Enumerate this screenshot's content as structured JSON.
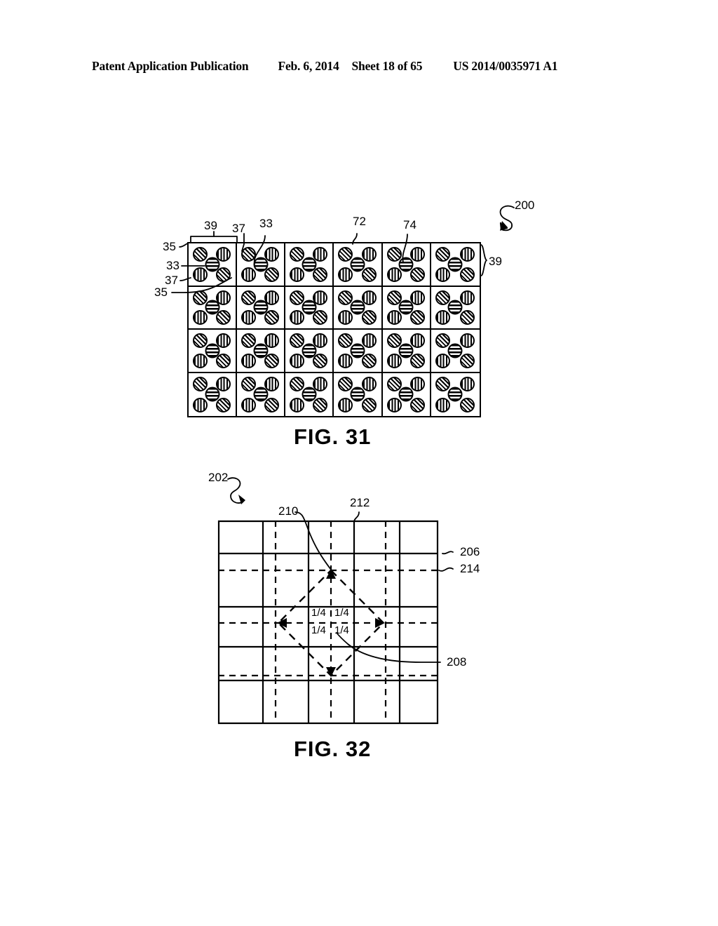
{
  "header": {
    "publication": "Patent Application Publication",
    "date": "Feb. 6, 2014",
    "sheet": "Sheet 18 of 65",
    "patent_number": "US 2014/0035971 A1"
  },
  "figures": [
    {
      "id": "fig31",
      "caption": "FIG. 31",
      "assembly_ref": "200",
      "grid": {
        "columns": 6,
        "rows": 4
      },
      "cell_elements": [
        {
          "position": "top-left",
          "hatch": "diagonal",
          "ref": "35"
        },
        {
          "position": "top-right",
          "hatch": "vertical",
          "ref": "37"
        },
        {
          "position": "center",
          "hatch": "horizontal",
          "ref": "33"
        },
        {
          "position": "bottom-left",
          "hatch": "vertical",
          "ref": "37"
        },
        {
          "position": "bottom-right",
          "hatch": "diagonal",
          "ref": "35"
        }
      ],
      "labels": {
        "top_39": "39",
        "top_37": "37",
        "top_33": "33",
        "top_72": "72",
        "top_74": "74",
        "left_35_upper": "35",
        "left_33": "33",
        "left_37": "37",
        "left_35_lower": "35",
        "right_39": "39",
        "callout_200": "200"
      }
    },
    {
      "id": "fig32",
      "caption": "FIG. 32",
      "assembly_ref": "202",
      "grid": {
        "columns": 5,
        "rows": 5
      },
      "labels": {
        "callout_202": "202",
        "lead_210": "210",
        "lead_212": "212",
        "lead_206": "206",
        "lead_214": "214",
        "lead_208": "208"
      },
      "quadrant_values": [
        "1/4",
        "1/4",
        "1/4",
        "1/4"
      ],
      "line_types": {
        "solid": "206",
        "dashed": "214"
      }
    }
  ]
}
